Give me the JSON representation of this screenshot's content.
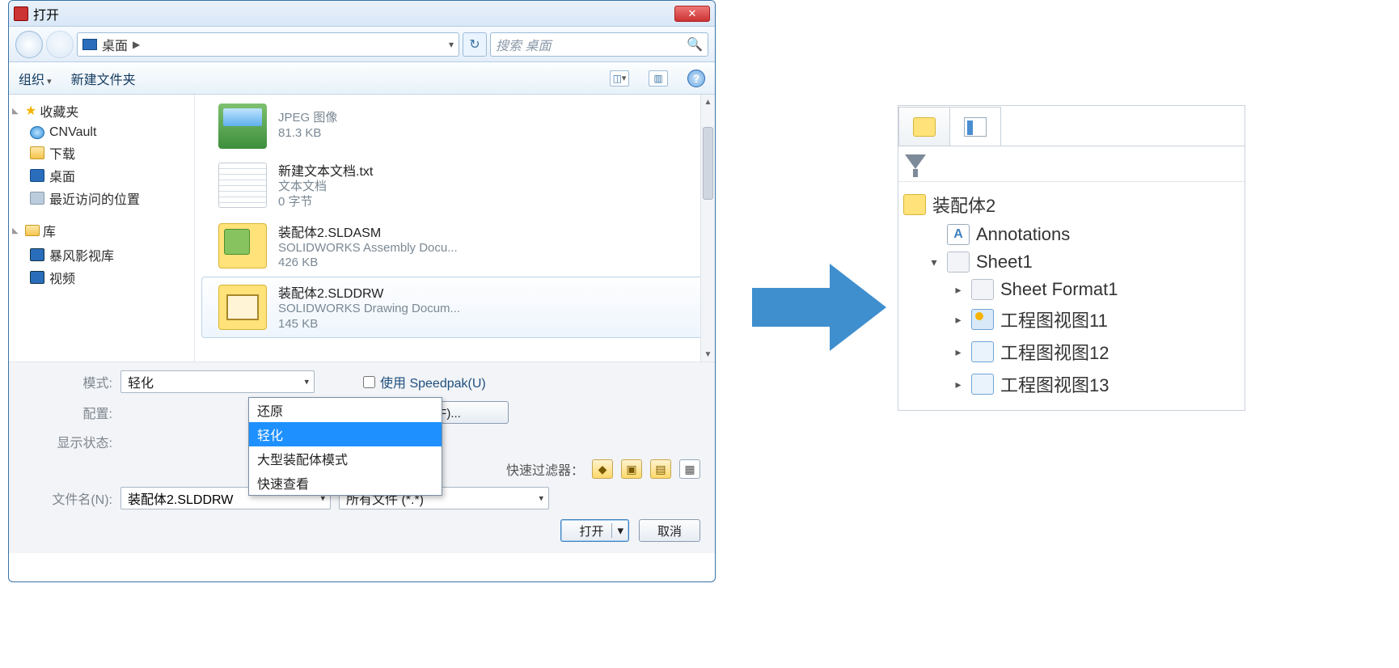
{
  "dialog": {
    "title": "打开",
    "breadcrumb": "桌面",
    "search_placeholder": "搜索 桌面",
    "toolbar": {
      "organize": "组织",
      "new_folder": "新建文件夹"
    },
    "sidebar": {
      "favorites_label": "收藏夹",
      "favorites": [
        {
          "icon": "globe",
          "label": "CNVault"
        },
        {
          "icon": "dl",
          "label": "下载"
        },
        {
          "icon": "desk",
          "label": "桌面"
        },
        {
          "icon": "recent",
          "label": "最近访问的位置"
        }
      ],
      "libraries_label": "库",
      "libraries": [
        {
          "icon": "vid",
          "label": "暴风影视库"
        },
        {
          "icon": "vid",
          "label": "视频"
        }
      ]
    },
    "files": [
      {
        "icon": "img",
        "name_hidden": true,
        "meta1": "JPEG 图像",
        "meta2": "81.3 KB"
      },
      {
        "icon": "txt",
        "name": "新建文本文档.txt",
        "meta1": "文本文档",
        "meta2": "0 字节"
      },
      {
        "icon": "asm",
        "name": "装配体2.SLDASM",
        "meta1": "SOLIDWORKS Assembly Docu...",
        "meta2": "426 KB"
      },
      {
        "icon": "drw",
        "name": "装配体2.SLDDRW",
        "meta1": "SOLIDWORKS Drawing Docum...",
        "meta2": "145 KB",
        "selected": true
      }
    ],
    "labels": {
      "mode": "模式:",
      "config": "配置:",
      "display_state": "显示状态:",
      "speedpak": "使用 Speedpak(U)",
      "references": "参考(F)...",
      "quick_filter": "快速过滤器：",
      "file_name": "文件名(N):",
      "file_type": "所有文件 (*.*)",
      "open": "打开",
      "cancel": "取消"
    },
    "mode_value": "轻化",
    "mode_options": [
      "还原",
      "轻化",
      "大型装配体模式",
      "快速查看"
    ],
    "mode_selected_index": 1,
    "file_name_value": "装配体2.SLDDRW"
  },
  "tree": {
    "root": "装配体2",
    "nodes": [
      {
        "level": 1,
        "icon": "ann",
        "label": "Annotations",
        "expand": ""
      },
      {
        "level": 1,
        "icon": "sheet",
        "label": "Sheet1",
        "expand": "▾"
      },
      {
        "level": 2,
        "icon": "fmt",
        "label": "Sheet Format1",
        "expand": "▸"
      },
      {
        "level": 2,
        "icon": "view",
        "label": "工程图视图11",
        "expand": "▸"
      },
      {
        "level": 2,
        "icon": "dview",
        "label": "工程图视图12",
        "expand": "▸"
      },
      {
        "level": 2,
        "icon": "dview",
        "label": "工程图视图13",
        "expand": "▸"
      }
    ]
  }
}
